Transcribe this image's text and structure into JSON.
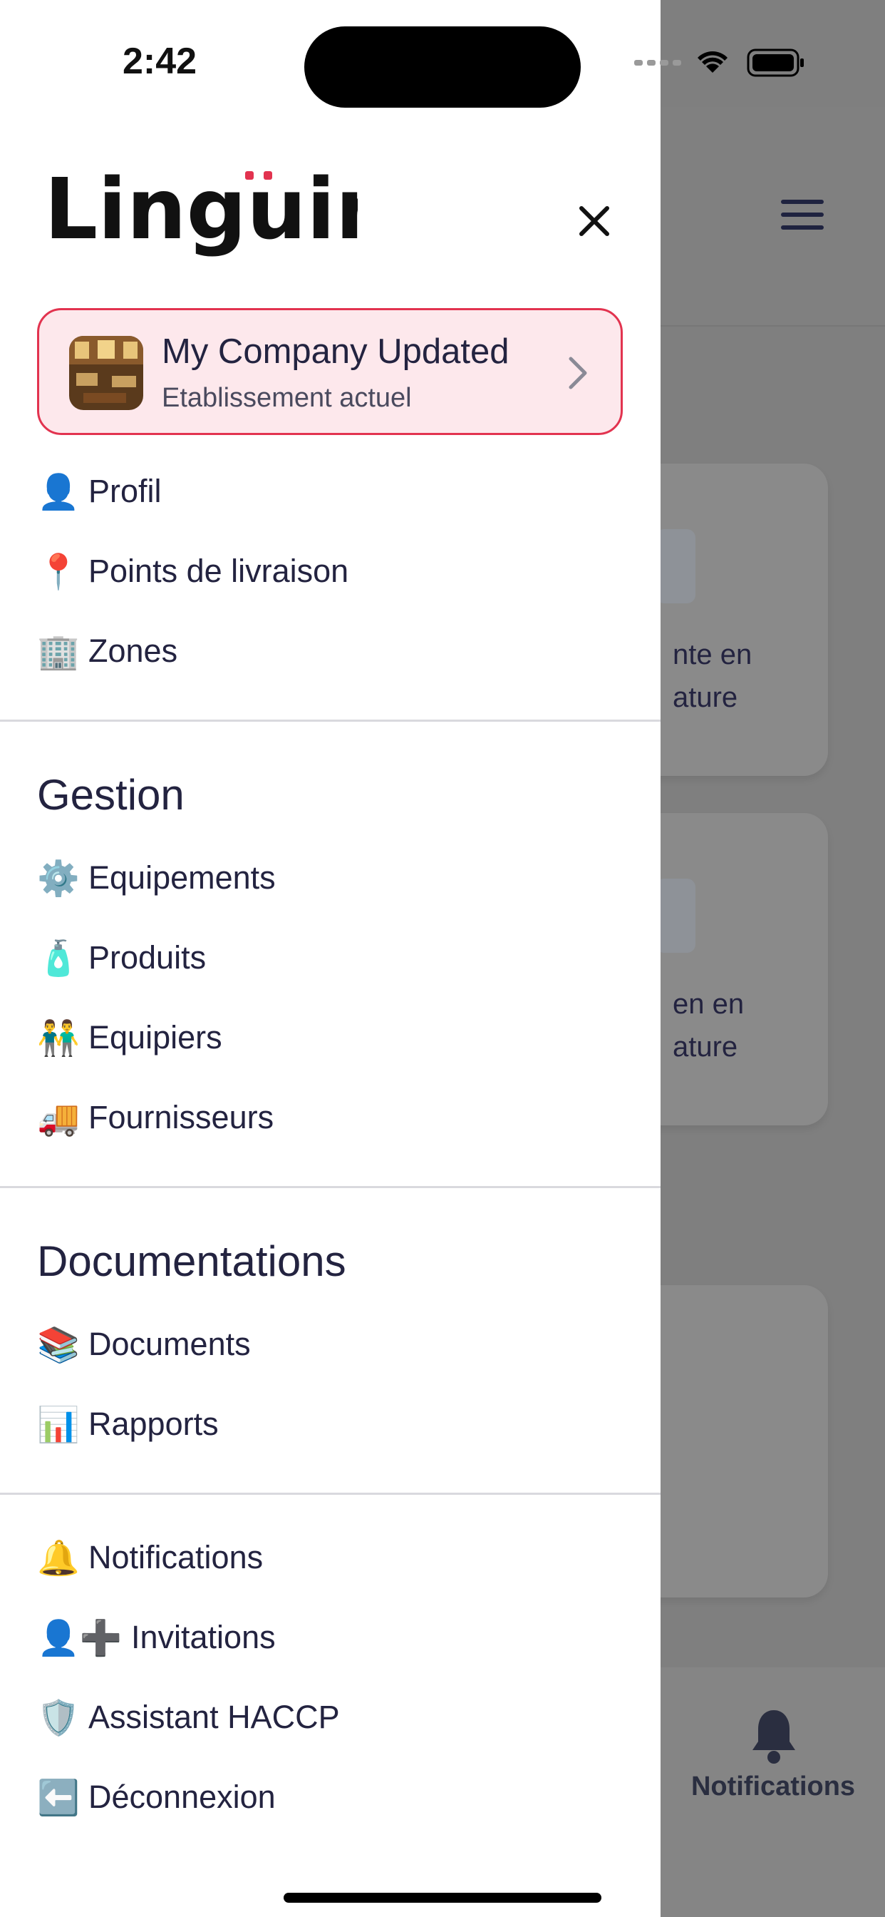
{
  "status_bar": {
    "time": "2:42"
  },
  "app": {
    "logo_text": "Linguini"
  },
  "company": {
    "name": "My Company Updated",
    "subtitle": "Etablissement actuel"
  },
  "account_items": [
    {
      "icon": "👤",
      "label": "Profil"
    },
    {
      "icon": "📍",
      "label": "Points de livraison"
    },
    {
      "icon": "🏢",
      "label": "Zones"
    }
  ],
  "gestion": {
    "title": "Gestion",
    "items": [
      {
        "icon": "⚙️",
        "label": "Equipements"
      },
      {
        "icon": "🧴",
        "label": "Produits"
      },
      {
        "icon": "👬",
        "label": "Equipiers"
      },
      {
        "icon": "🚚",
        "label": "Fournisseurs"
      }
    ]
  },
  "documentations": {
    "title": "Documentations",
    "items": [
      {
        "icon": "📚",
        "label": "Documents"
      },
      {
        "icon": "📊",
        "label": "Rapports"
      }
    ]
  },
  "bottom_items": [
    {
      "icon": "🔔",
      "label": "Notifications"
    },
    {
      "icon": "👤➕",
      "label": "Invitations"
    },
    {
      "icon": "🛡️",
      "label": "Assistant HACCP"
    },
    {
      "icon": "⬅️",
      "label": "Déconnexion"
    }
  ],
  "background": {
    "card1_text": "nte en\nature",
    "card2_text": "en en\nature",
    "tab_label": "Notifications"
  },
  "colors": {
    "accent": "#e2334f",
    "card_bg": "#fde8ec",
    "text": "#232340",
    "overlay": "#7f7f7f"
  }
}
